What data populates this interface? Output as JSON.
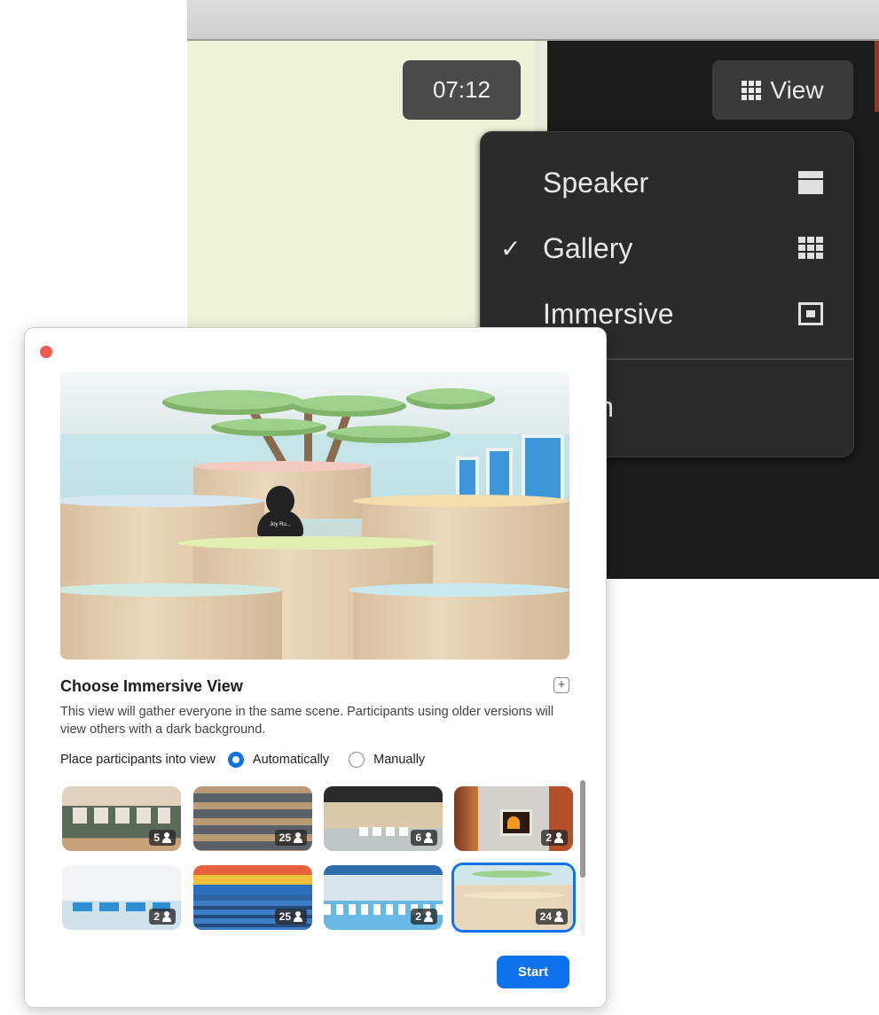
{
  "meeting": {
    "timer": "07:12",
    "view_button": {
      "label": "View",
      "icon": "grid-icon"
    },
    "view_menu": {
      "items": [
        {
          "label": "Speaker",
          "checked": false,
          "icon": "speaker-view-icon"
        },
        {
          "label": "Gallery",
          "checked": true,
          "icon": "gallery-view-icon"
        },
        {
          "label": "Immersive",
          "checked": false,
          "icon": "immersive-view-icon"
        },
        {
          "label": "Fullscreen",
          "visible_text": "creen",
          "checked": false
        }
      ],
      "check_glyph": "✓"
    }
  },
  "dialog": {
    "title": "Choose Immersive View",
    "description": "This view will gather everyone in the same scene. Participants using older versions will view others with a dark background.",
    "place_label": "Place participants into view",
    "options": [
      {
        "label": "Automatically",
        "selected": true
      },
      {
        "label": "Manually",
        "selected": false
      }
    ],
    "preview_avatar_label": "Joy Ru...",
    "add_icon": "plus-icon",
    "scenes": [
      {
        "count": "5",
        "selected": false
      },
      {
        "count": "25",
        "selected": false
      },
      {
        "count": "6",
        "selected": false
      },
      {
        "count": "2",
        "selected": false
      },
      {
        "count": "2",
        "selected": false
      },
      {
        "count": "25",
        "selected": false
      },
      {
        "count": "2",
        "selected": false
      },
      {
        "count": "24",
        "selected": true
      }
    ],
    "start_label": "Start",
    "accent_color": "#0e72ed",
    "close_color": "#ee5b52"
  }
}
